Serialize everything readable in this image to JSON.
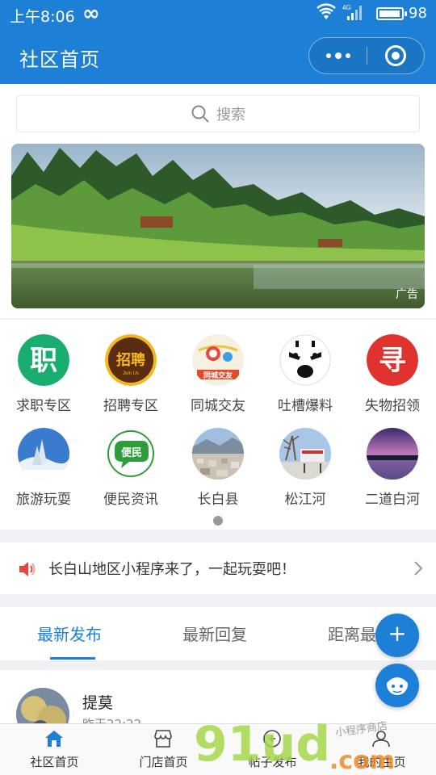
{
  "status_bar": {
    "time": "上午8:06",
    "battery_level": "98",
    "battery_fraction": 0.98,
    "network_label": "4G"
  },
  "nav": {
    "title": "社区首页"
  },
  "search": {
    "placeholder": "搜索"
  },
  "banner": {
    "ad_label": "广告"
  },
  "categories": [
    {
      "label": "求职专区",
      "icon": "job-icon",
      "icon_text": "职",
      "color": "#1aad70"
    },
    {
      "label": "招聘专区",
      "icon": "recruit-icon",
      "icon_text": "招聘",
      "sub_text": "Join Us",
      "color": "#5a2d12"
    },
    {
      "label": "同城交友",
      "icon": "friends-icon",
      "icon_text": "同城交友",
      "color": "#f5c445"
    },
    {
      "label": "吐槽爆料",
      "icon": "complain-icon",
      "color": "#222222"
    },
    {
      "label": "失物招领",
      "icon": "lost-found-icon",
      "icon_text": "寻",
      "color": "#e0322e"
    },
    {
      "label": "旅游玩耍",
      "icon": "travel-icon",
      "color": "#3a7bd0"
    },
    {
      "label": "便民资讯",
      "icon": "convenience-icon",
      "icon_text": "便民",
      "color": "#2f9d3b"
    },
    {
      "label": "长白县",
      "icon": "changbai-icon",
      "color": "#8aa7c9"
    },
    {
      "label": "松江河",
      "icon": "songjianghe-icon",
      "color": "#6b9bd1"
    },
    {
      "label": "二道白河",
      "icon": "erdaobaihe-icon",
      "color": "#5a3f8c"
    }
  ],
  "notice": {
    "text": "长白山地区小程序来了，一起玩耍吧！"
  },
  "tabs": [
    {
      "label": "最新发布",
      "active": true
    },
    {
      "label": "最新回复",
      "active": false
    },
    {
      "label": "距离最近",
      "active": false
    }
  ],
  "post": {
    "author": "提莫",
    "time": "昨天22:22"
  },
  "fab": {
    "add_label": "+"
  },
  "tabbar": [
    {
      "label": "社区首页",
      "icon": "home-icon"
    },
    {
      "label": "门店首页",
      "icon": "store-icon"
    },
    {
      "label": "帖子发布",
      "icon": "publish-icon"
    },
    {
      "label": "我的主页",
      "icon": "profile-icon"
    }
  ],
  "watermark": {
    "text": "91ud",
    "suffix": ".com",
    "tagline": "小程序商店"
  },
  "colors": {
    "brand": "#1e7fd6",
    "background": "#efeff4"
  }
}
